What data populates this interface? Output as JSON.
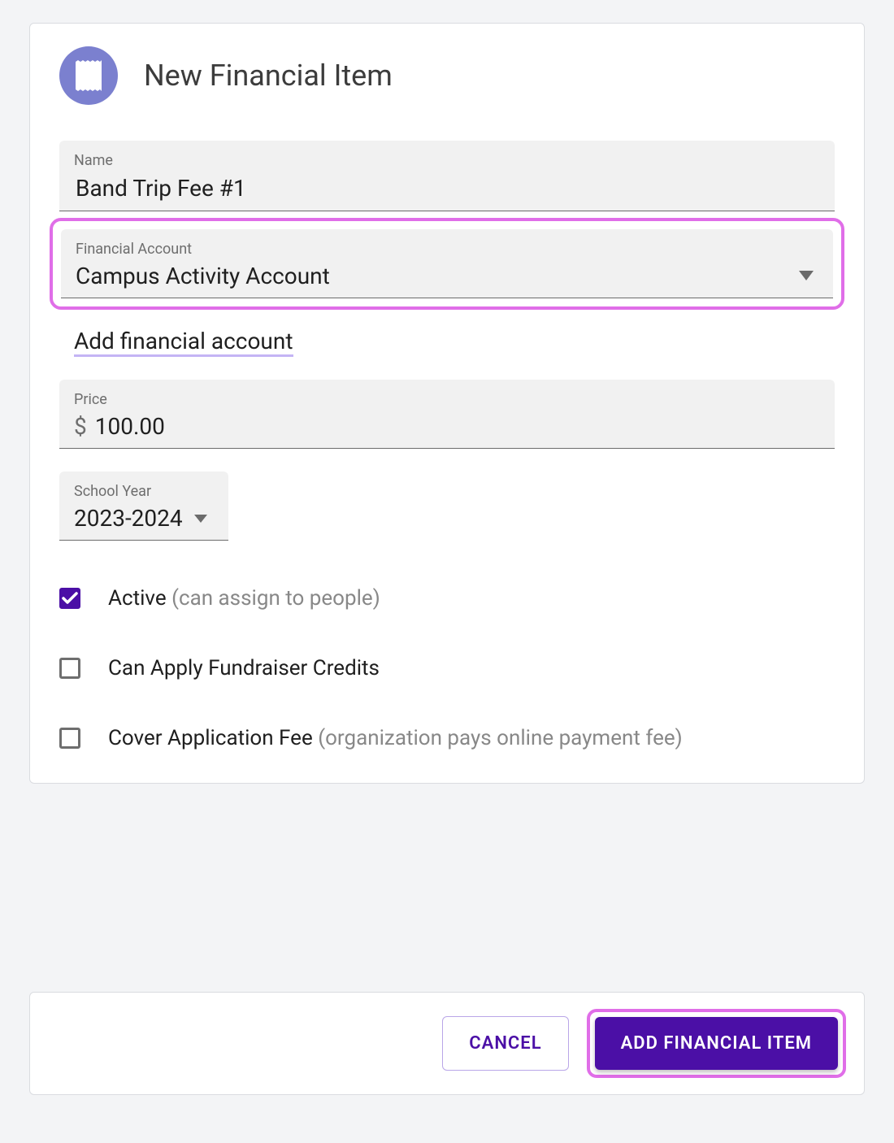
{
  "header": {
    "title": "New Financial Item",
    "icon": "receipt-icon"
  },
  "fields": {
    "name": {
      "label": "Name",
      "value": "Band Trip Fee #1"
    },
    "account": {
      "label": "Financial Account",
      "value": "Campus Activity Account"
    },
    "add_account_link": "Add financial account",
    "price": {
      "label": "Price",
      "currency": "$",
      "value": "100.00"
    },
    "school_year": {
      "label": "School Year",
      "value": "2023-2024"
    }
  },
  "checks": {
    "active": {
      "label": "Active",
      "hint": "(can assign to people)",
      "checked": true
    },
    "fundraiser": {
      "label": "Can Apply Fundraiser Credits",
      "hint": "",
      "checked": false
    },
    "cover_fee": {
      "label": "Cover Application Fee",
      "hint": "(organization pays online payment fee)",
      "checked": false
    }
  },
  "footer": {
    "cancel": "CANCEL",
    "submit": "ADD FINANCIAL ITEM"
  }
}
